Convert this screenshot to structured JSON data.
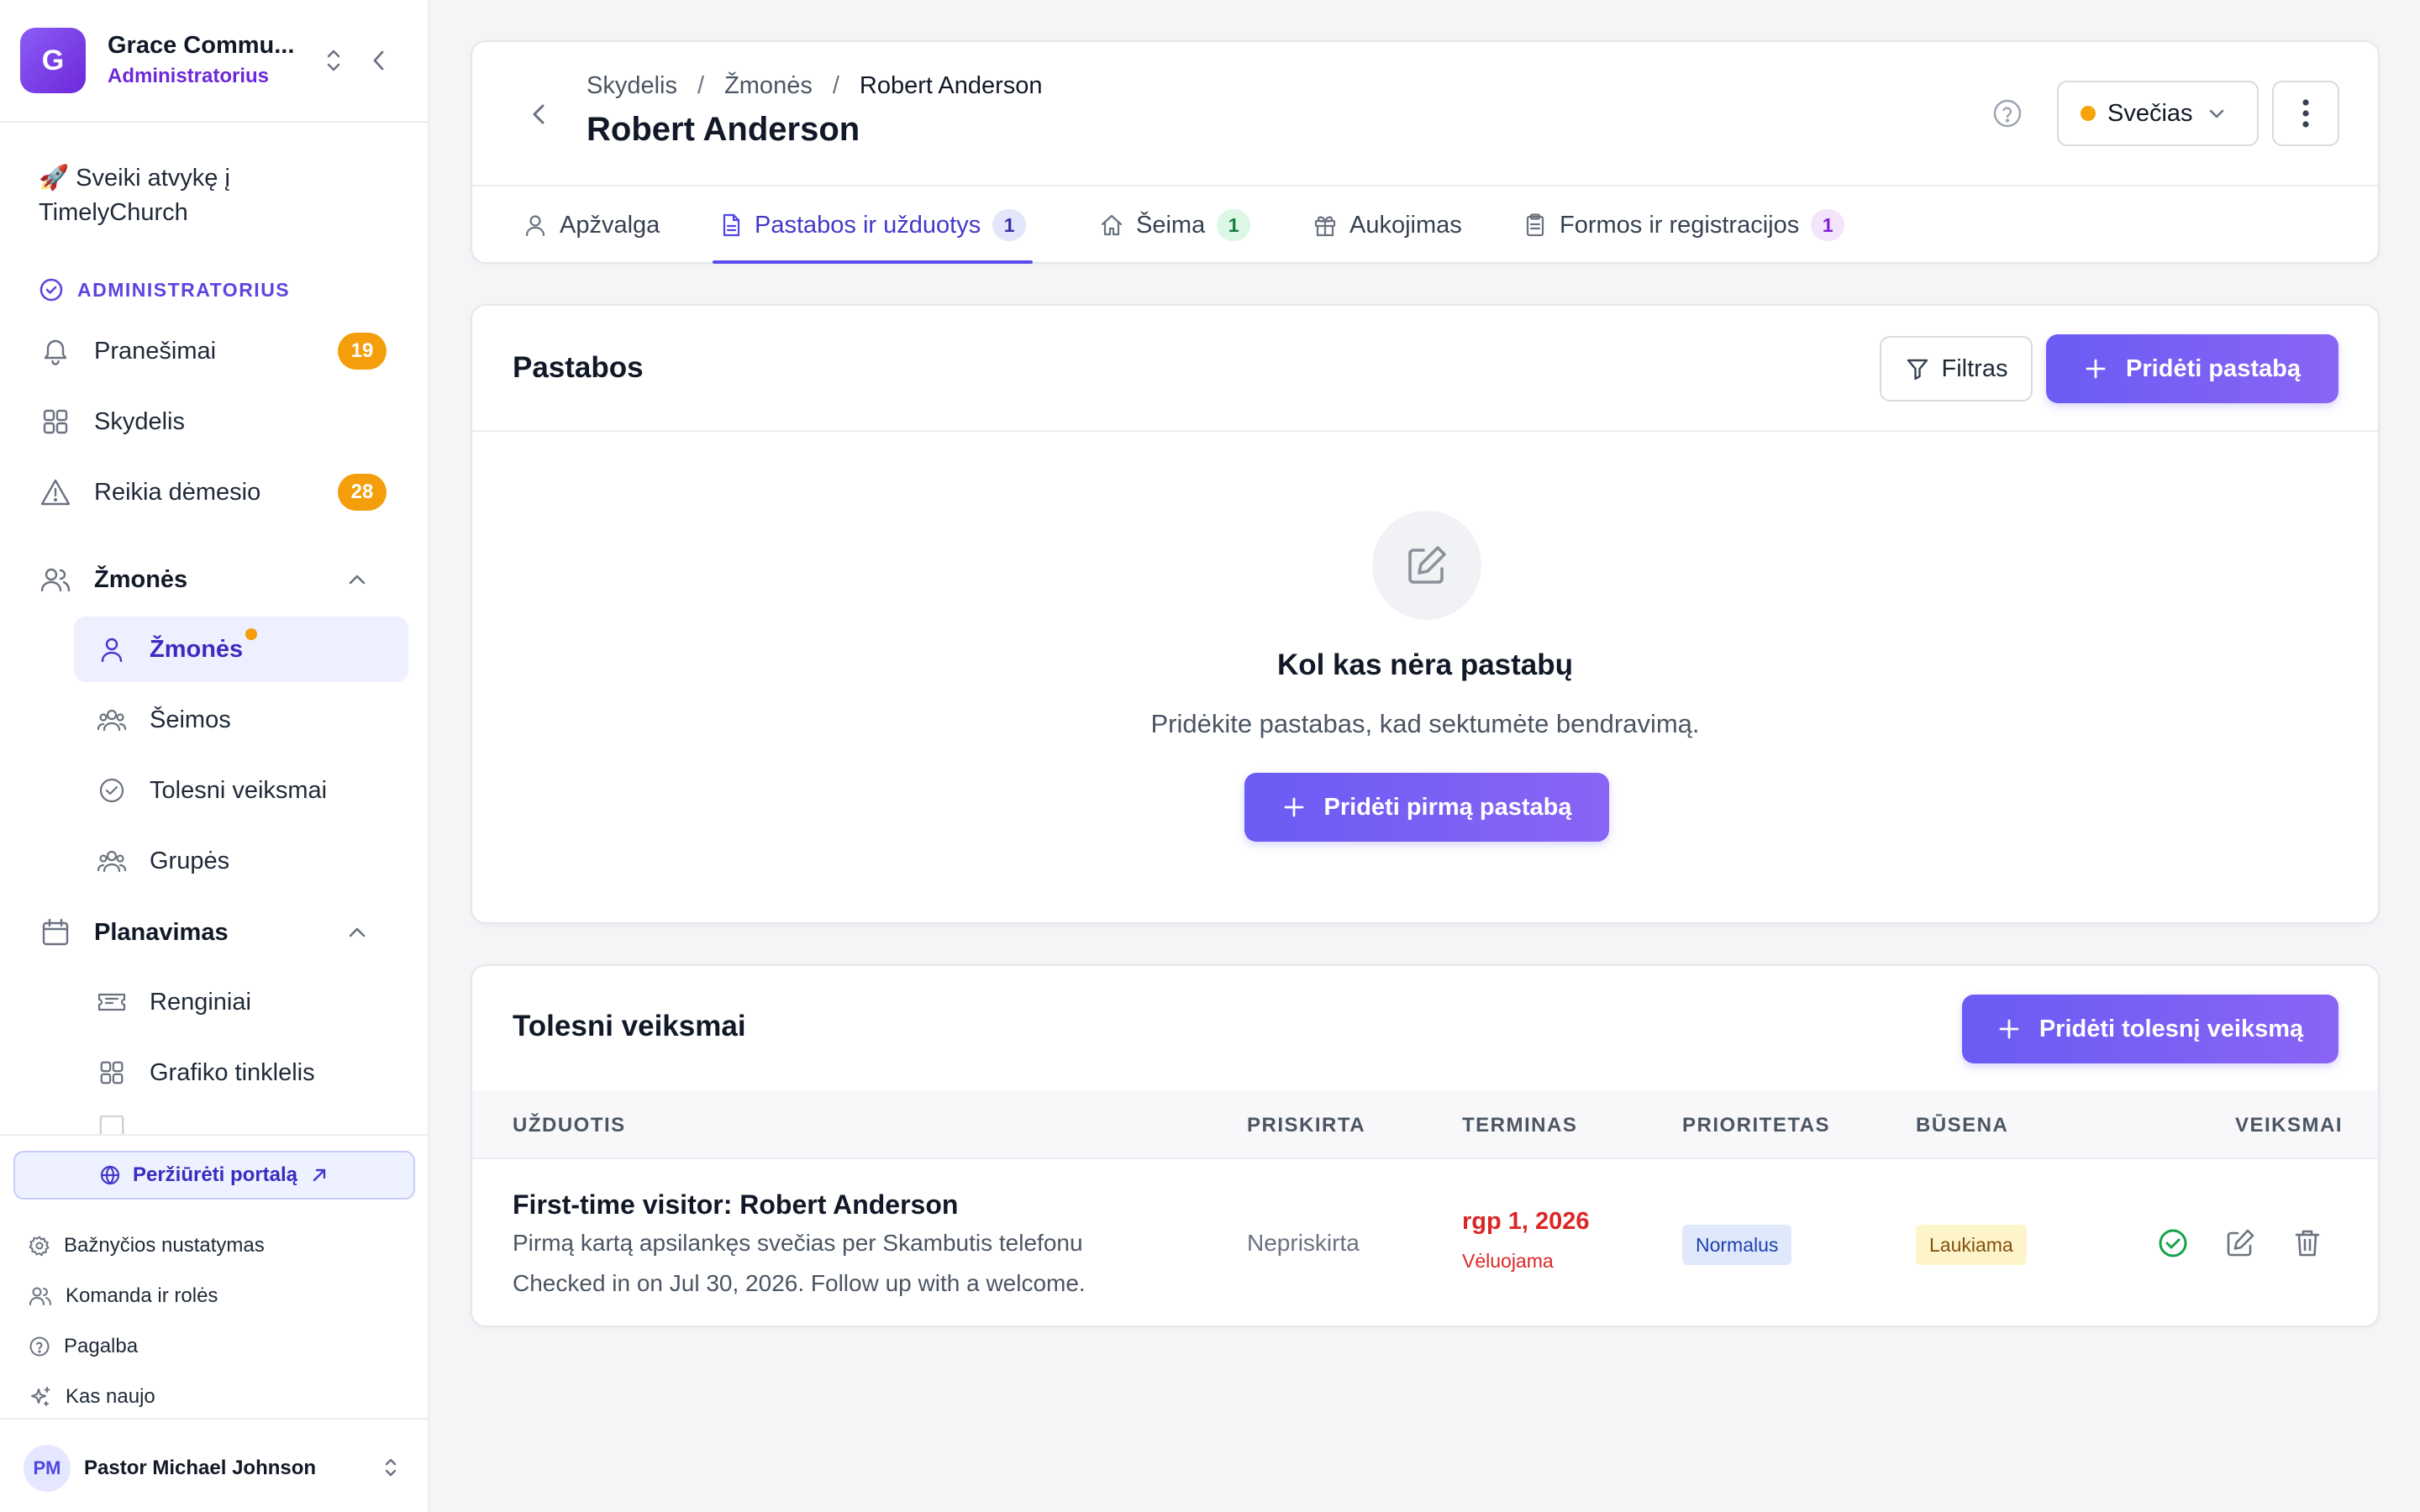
{
  "sidebar": {
    "org": {
      "initial": "G",
      "name": "Grace Commu...",
      "role": "Administratorius"
    },
    "welcome": "🚀 Sveiki atvykę į TimelyChurch",
    "admin_label": "ADMINISTRATORIUS",
    "items": [
      {
        "label": "Pranešimai",
        "badge": "19",
        "icon": "bell-icon"
      },
      {
        "label": "Skydelis",
        "icon": "grid-icon"
      },
      {
        "label": "Reikia dėmesio",
        "badge": "28",
        "icon": "warning-icon"
      }
    ],
    "people_section": {
      "label": "Žmonės",
      "items": [
        {
          "label": "Žmonės",
          "active": true,
          "icon": "user-icon"
        },
        {
          "label": "Šeimos",
          "icon": "users-icon"
        },
        {
          "label": "Tolesni veiksmai",
          "icon": "check-circle-icon"
        },
        {
          "label": "Grupės",
          "icon": "users-icon"
        }
      ]
    },
    "planning_section": {
      "label": "Planavimas",
      "items": [
        {
          "label": "Renginiai",
          "icon": "ticket-icon"
        },
        {
          "label": "Grafiko tinklelis",
          "icon": "grid-icon"
        }
      ]
    },
    "portal_button": "Peržiūrėti portalą",
    "footer_links": [
      {
        "label": "Bažnyčios nustatymas",
        "icon": "gear-icon"
      },
      {
        "label": "Komanda ir rolės",
        "icon": "team-icon"
      },
      {
        "label": "Pagalba",
        "icon": "help-icon"
      },
      {
        "label": "Kas naujo",
        "icon": "sparkle-icon"
      }
    ],
    "user": {
      "initials": "PM",
      "name": "Pastor Michael Johnson"
    }
  },
  "header": {
    "breadcrumb": [
      "Skydelis",
      "Žmonės",
      "Robert Anderson"
    ],
    "title": "Robert Anderson",
    "status": "Svečias",
    "status_color": "#f5a50b",
    "tabs": [
      {
        "label": "Apžvalga",
        "icon": "user-icon"
      },
      {
        "label": "Pastabos ir užduotys",
        "count": "1",
        "active": true,
        "icon": "document-icon"
      },
      {
        "label": "Šeima",
        "count": "1",
        "icon": "home-icon"
      },
      {
        "label": "Aukojimas",
        "icon": "gift-icon"
      },
      {
        "label": "Formos ir registracijos",
        "count": "1",
        "icon": "clipboard-icon"
      }
    ]
  },
  "notes": {
    "title": "Pastabos",
    "filter_label": "Filtras",
    "add_label": "Pridėti pastabą",
    "empty_title": "Kol kas nėra pastabų",
    "empty_desc": "Pridėkite pastabas, kad sektumėte bendravimą.",
    "empty_button": "Pridėti pirmą pastabą"
  },
  "followups": {
    "title": "Tolesni veiksmai",
    "add_label": "Pridėti tolesnį veiksmą",
    "columns": [
      "UŽDUOTIS",
      "PRISKIRTA",
      "TERMINAS",
      "PRIORITETAS",
      "BŪSENA",
      "VEIKSMAI"
    ],
    "rows": [
      {
        "title": "First-time visitor: Robert Anderson",
        "subtitle": "Pirmą kartą apsilankęs svečias per Skambutis telefonu",
        "detail": "Checked in on Jul 30, 2026. Follow up with a welcome.",
        "assigned": "Nepriskirta",
        "due": "rgp 1, 2026",
        "due_status": "Vėluojama",
        "priority": "Normalus",
        "state": "Laukiama"
      }
    ]
  },
  "colors": {
    "accent": "#5b4cf0",
    "badge_orange": "#f59e0b",
    "overdue_red": "#dc2626"
  }
}
